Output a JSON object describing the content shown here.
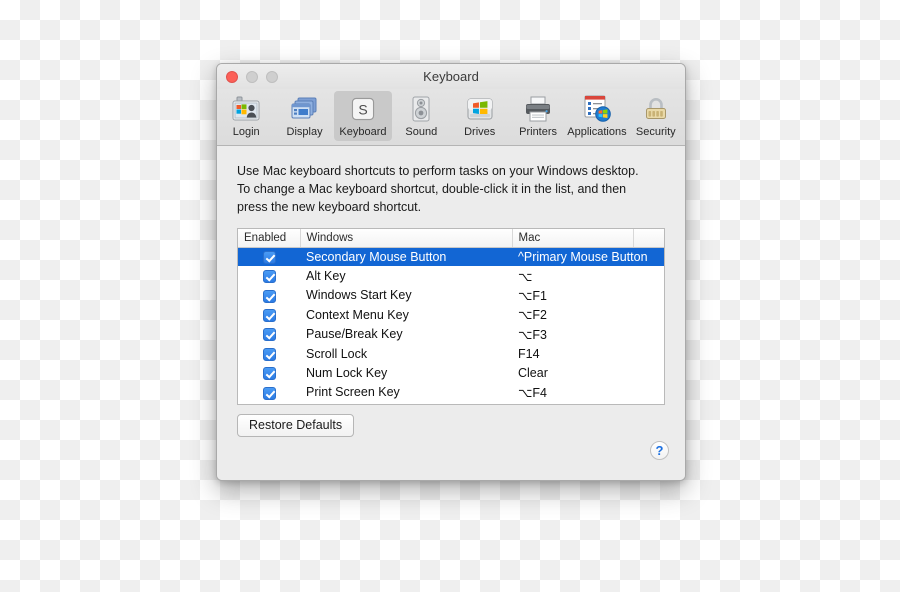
{
  "window": {
    "title": "Keyboard",
    "traffic_lights": [
      {
        "name": "close",
        "color": "#fc6058"
      },
      {
        "name": "minimize",
        "color": "#cfcfcf"
      },
      {
        "name": "zoom",
        "color": "#cfcfcf"
      }
    ]
  },
  "toolbar": {
    "items": [
      {
        "label": "Login",
        "icon": "login-badge-icon",
        "selected": false
      },
      {
        "label": "Display",
        "icon": "display-windows-icon",
        "selected": false
      },
      {
        "label": "Keyboard",
        "icon": "keyboard-key-s-icon",
        "selected": true
      },
      {
        "label": "Sound",
        "icon": "speaker-icon",
        "selected": false
      },
      {
        "label": "Drives",
        "icon": "hard-drive-icon",
        "selected": false
      },
      {
        "label": "Printers",
        "icon": "printer-icon",
        "selected": false
      },
      {
        "label": "Applications",
        "icon": "applications-icon",
        "selected": false
      },
      {
        "label": "Security",
        "icon": "padlock-icon",
        "selected": false
      }
    ]
  },
  "content": {
    "description": "Use Mac keyboard shortcuts to perform tasks on your Windows desktop. To change a Mac keyboard shortcut, double-click it in the list, and then press the new keyboard shortcut.",
    "table": {
      "columns": [
        "Enabled",
        "Windows",
        "Mac"
      ],
      "rows": [
        {
          "enabled": true,
          "windows": "Secondary Mouse Button",
          "mac": "^Primary Mouse Button",
          "selected": true
        },
        {
          "enabled": true,
          "windows": "Alt Key",
          "mac": "⌥",
          "selected": false
        },
        {
          "enabled": true,
          "windows": "Windows Start Key",
          "mac": "⌥F1",
          "selected": false
        },
        {
          "enabled": true,
          "windows": "Context Menu Key",
          "mac": "⌥F2",
          "selected": false
        },
        {
          "enabled": true,
          "windows": "Pause/Break Key",
          "mac": "⌥F3",
          "selected": false
        },
        {
          "enabled": true,
          "windows": "Scroll Lock",
          "mac": "F14",
          "selected": false
        },
        {
          "enabled": true,
          "windows": "Num Lock Key",
          "mac": "Clear",
          "selected": false
        },
        {
          "enabled": true,
          "windows": "Print Screen Key",
          "mac": "⌥F4",
          "selected": false
        }
      ]
    },
    "restore_defaults_label": "Restore Defaults",
    "help_label": "?"
  },
  "colors": {
    "selection_blue": "#1266d4",
    "checkbox_blue": "#2b7be4",
    "help_blue": "#1b6fe0",
    "close_red": "#fc6058",
    "window_bg": "#ececec"
  }
}
